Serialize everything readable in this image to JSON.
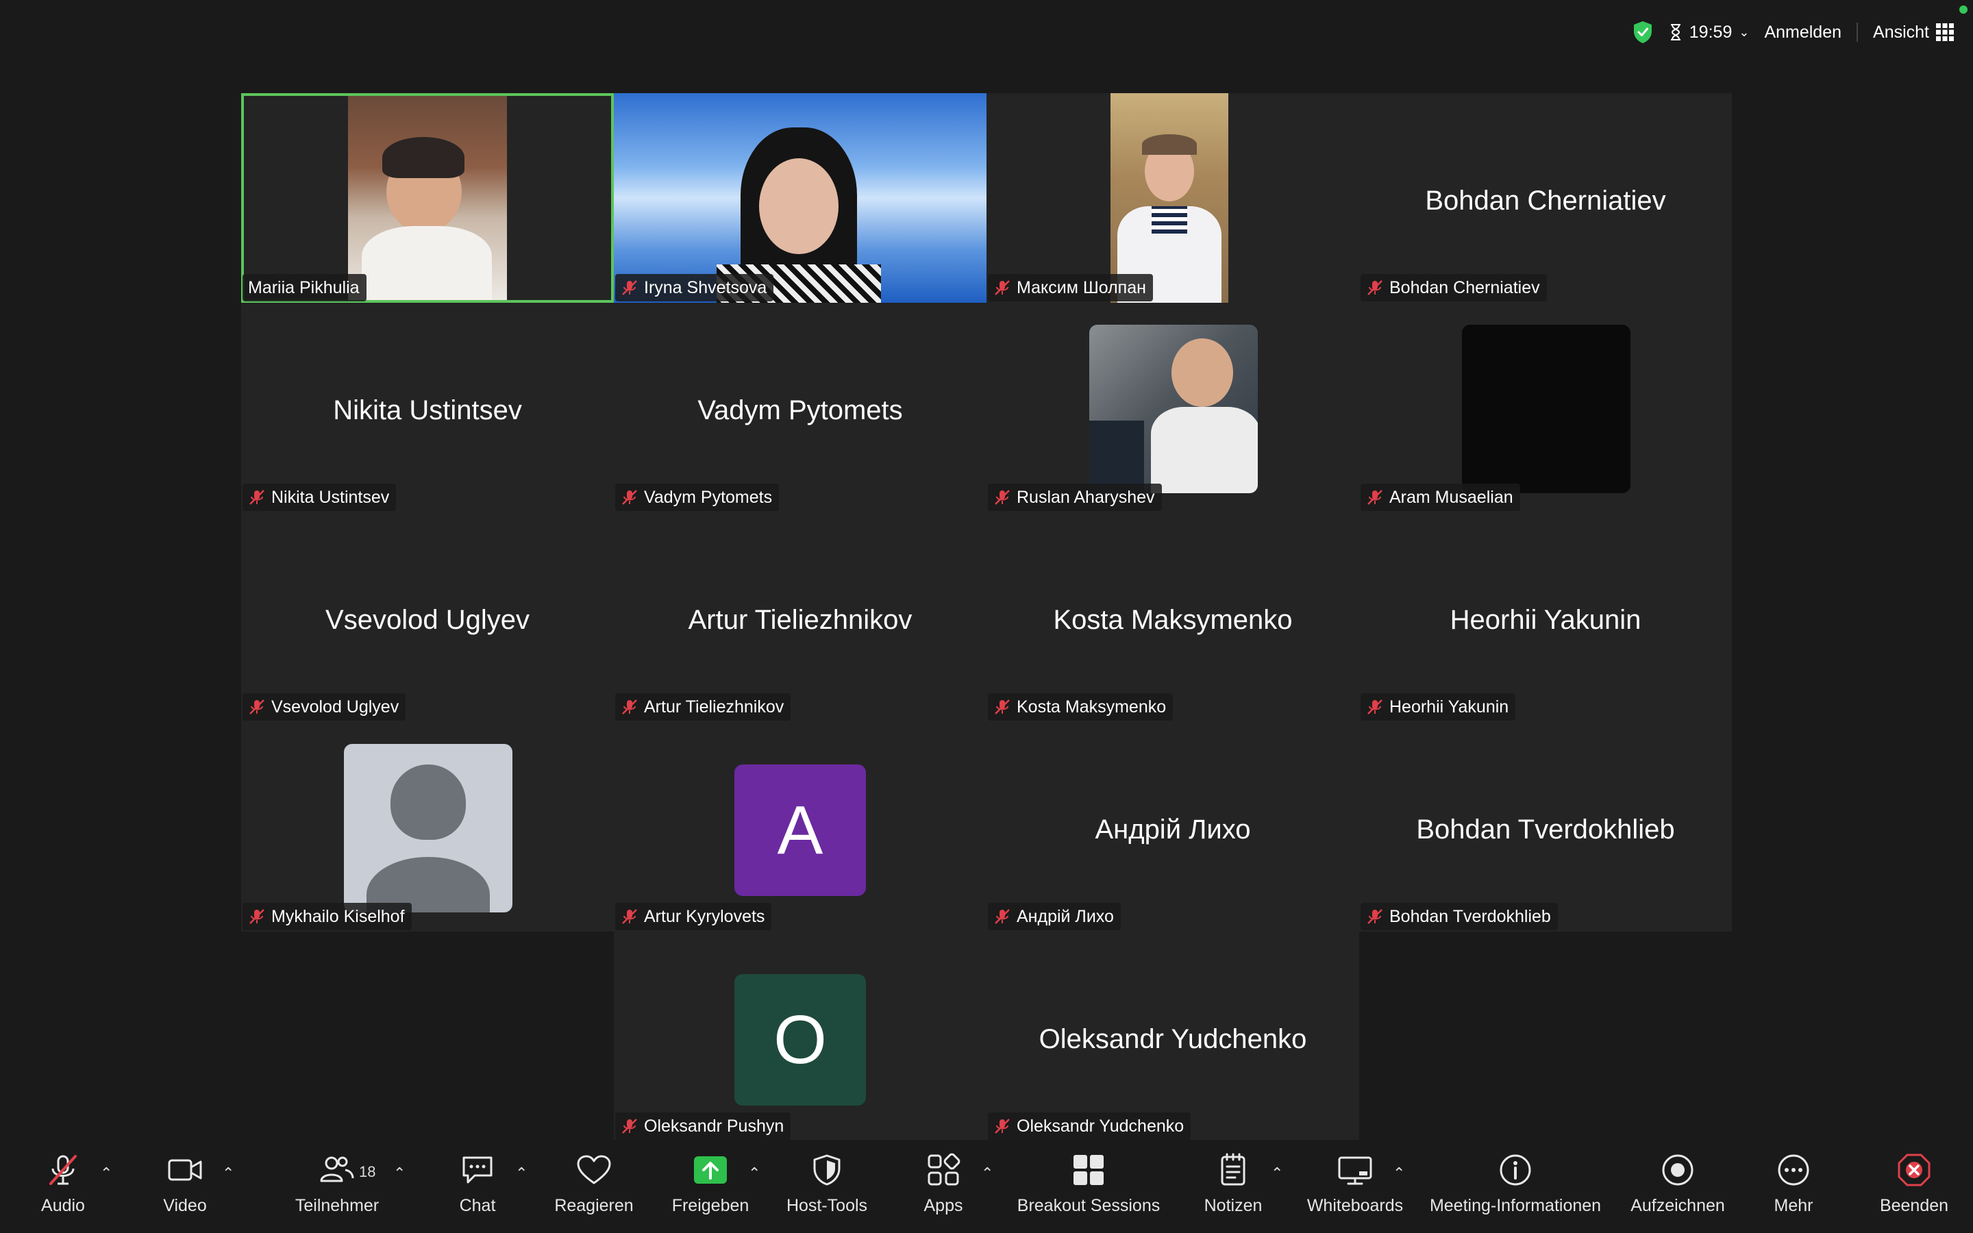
{
  "topbar": {
    "timer": "19:59",
    "signin": "Anmelden",
    "view": "Ansicht"
  },
  "participants": [
    {
      "tile_name": "",
      "tag": "Mariia Pikhulia",
      "muted": false,
      "kind": "video"
    },
    {
      "tile_name": "",
      "tag": "Iryna Shvetsova",
      "muted": true,
      "kind": "video"
    },
    {
      "tile_name": "",
      "tag": "Максим Шолпан",
      "muted": true,
      "kind": "video"
    },
    {
      "tile_name": "Bohdan Cherniatiev",
      "tag": "Bohdan Cherniatiev",
      "muted": true,
      "kind": "name"
    },
    {
      "tile_name": "Nikita Ustintsev",
      "tag": "Nikita Ustintsev",
      "muted": true,
      "kind": "name"
    },
    {
      "tile_name": "Vadym Pytomets",
      "tag": "Vadym Pytomets",
      "muted": true,
      "kind": "name"
    },
    {
      "tile_name": "",
      "tag": "Ruslan Aharyshev",
      "muted": true,
      "kind": "video"
    },
    {
      "tile_name": "",
      "tag": "Aram Musaelian",
      "muted": true,
      "kind": "black"
    },
    {
      "tile_name": "Vsevolod Uglyev",
      "tag": "Vsevolod Uglyev",
      "muted": true,
      "kind": "name"
    },
    {
      "tile_name": "Artur Tieliezhnikov",
      "tag": "Artur Tieliezhnikov",
      "muted": true,
      "kind": "name"
    },
    {
      "tile_name": "Kosta Maksymenko",
      "tag": "Kosta Maksymenko",
      "muted": true,
      "kind": "name"
    },
    {
      "tile_name": "Heorhii Yakunin",
      "tag": "Heorhii Yakunin",
      "muted": true,
      "kind": "name"
    },
    {
      "tile_name": "",
      "tag": "Mykhailo Kiselhof",
      "muted": true,
      "kind": "person"
    },
    {
      "tile_name": "A",
      "tag": "Artur Kyrylovets",
      "muted": true,
      "kind": "letter",
      "color": "#6b2aa0"
    },
    {
      "tile_name": "Андрій Лихо",
      "tag": "Андрій Лихо",
      "muted": true,
      "kind": "name"
    },
    {
      "tile_name": "Bohdan Tverdokhlieb",
      "tag": "Bohdan Tverdokhlieb",
      "muted": true,
      "kind": "name"
    },
    {
      "tile_name": "O",
      "tag": "Oleksandr Pushyn",
      "muted": true,
      "kind": "letter",
      "color": "#1e4a3d"
    },
    {
      "tile_name": "Oleksandr Yudchenko",
      "tag": "Oleksandr Yudchenko",
      "muted": true,
      "kind": "name"
    }
  ],
  "toolbar": {
    "audio": "Audio",
    "video": "Video",
    "participants": "Teilnehmer",
    "participants_count": "18",
    "chat": "Chat",
    "react": "Reagieren",
    "share": "Freigeben",
    "host_tools": "Host-Tools",
    "apps": "Apps",
    "breakout": "Breakout Sessions",
    "notes": "Notizen",
    "whiteboards": "Whiteboards",
    "meeting_info": "Meeting-Informationen",
    "record": "Aufzeichnen",
    "more": "Mehr",
    "end": "Beenden"
  },
  "colors": {
    "active_speaker": "#5dc55c",
    "muted_icon": "#e0404a",
    "share_green": "#2fbf4c",
    "end_red": "#e0404a"
  }
}
